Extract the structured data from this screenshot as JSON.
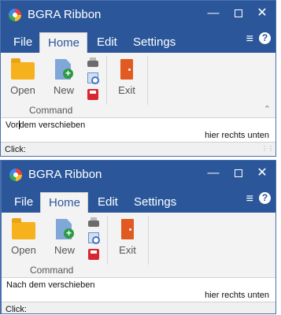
{
  "windows": [
    {
      "title": "BGRA Ribbon",
      "tabs": [
        "File",
        "Home",
        "Edit",
        "Settings"
      ],
      "active_tab": "Home",
      "buttons": {
        "open": "Open",
        "new": "New",
        "exit": "Exit"
      },
      "group_label": "Command",
      "text_left_before": "Vor",
      "text_left_after": "dem verschieben",
      "text_right": "hier rechts unten",
      "status": "Click:"
    },
    {
      "title": "BGRA Ribbon",
      "tabs": [
        "File",
        "Home",
        "Edit",
        "Settings"
      ],
      "active_tab": "Home",
      "buttons": {
        "open": "Open",
        "new": "New",
        "exit": "Exit"
      },
      "group_label": "Command",
      "text_left": "Nach dem verschieben",
      "text_right": "hier rechts unten",
      "status": "Click:"
    }
  ],
  "icons": {
    "app": "app-icon",
    "minimize": "minimize-icon",
    "maximize": "maximize-icon",
    "close": "close-icon",
    "menu": "hamburger-icon",
    "help": "help-icon",
    "open": "folder-icon",
    "new": "new-document-icon",
    "print": "printer-icon",
    "preview": "print-preview-icon",
    "save": "save-icon",
    "exit": "exit-door-icon"
  },
  "colors": {
    "title_bar": "#2b579a",
    "ribbon": "#f3f3f3",
    "accent_text": "#2b579a"
  }
}
